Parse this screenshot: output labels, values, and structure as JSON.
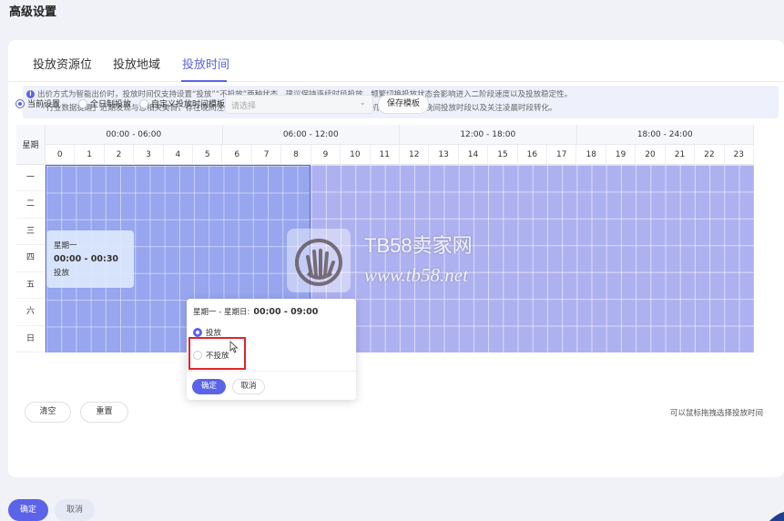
{
  "page_title": "高级设置",
  "tabs": [
    {
      "label": "投放资源位",
      "active": false
    },
    {
      "label": "投放地域",
      "active": false
    },
    {
      "label": "投放时间",
      "active": true
    }
  ],
  "notice": {
    "line1": "出价方式为智能出价时，投放时间仅支持设置“投放”“不投放”两种状态，建议保持连续时段投放，频繁切换投放状态会影响进入二阶段速度以及投放稳定性。",
    "line2": "「行业数据提醒」近期发现与您相关类目，存在晚间注地机会，以及凌晨时段最近发现了低价转化机会，建议延长晚间投放时段以及关注凌晨时段转化。"
  },
  "options": {
    "current": "当前设置",
    "all_day": "全日制投放",
    "custom_template": "自定义投放时间模板",
    "select_placeholder": "请选择",
    "save_template": "保存模板"
  },
  "grid": {
    "weekday_header": "星期",
    "ranges": [
      "00:00 - 06:00",
      "06:00 - 12:00",
      "12:00 - 18:00",
      "18:00 - 24:00"
    ],
    "hours": [
      "0",
      "1",
      "2",
      "3",
      "4",
      "5",
      "6",
      "7",
      "8",
      "9",
      "10",
      "11",
      "12",
      "13",
      "14",
      "15",
      "16",
      "17",
      "18",
      "19",
      "20",
      "21",
      "22",
      "23"
    ],
    "days": [
      "一",
      "二",
      "三",
      "四",
      "五",
      "六",
      "日"
    ]
  },
  "hover_tip": {
    "day": "星期一",
    "time": "00:00 - 00:30",
    "status": "投放"
  },
  "popover": {
    "title_prefix": "星期一 - 星期日:",
    "title_time": "00:00 - 09:00",
    "option_deliver": "投放",
    "option_no_deliver": "不投放",
    "ok": "确定",
    "cancel": "取消"
  },
  "actions": {
    "clear": "清空",
    "reset": "重置",
    "hint": "可以鼠标拖拽选择投放时间"
  },
  "footer": {
    "ok": "确定",
    "cancel": "取消"
  },
  "watermark": {
    "line1": "TB58卖家网",
    "line2": "www.tb58.net"
  },
  "colors": {
    "accent": "#5b63e8",
    "slot_on": "#aeb1f0",
    "slot_selected": "#97a6ee",
    "highlight": "#e0242b"
  }
}
